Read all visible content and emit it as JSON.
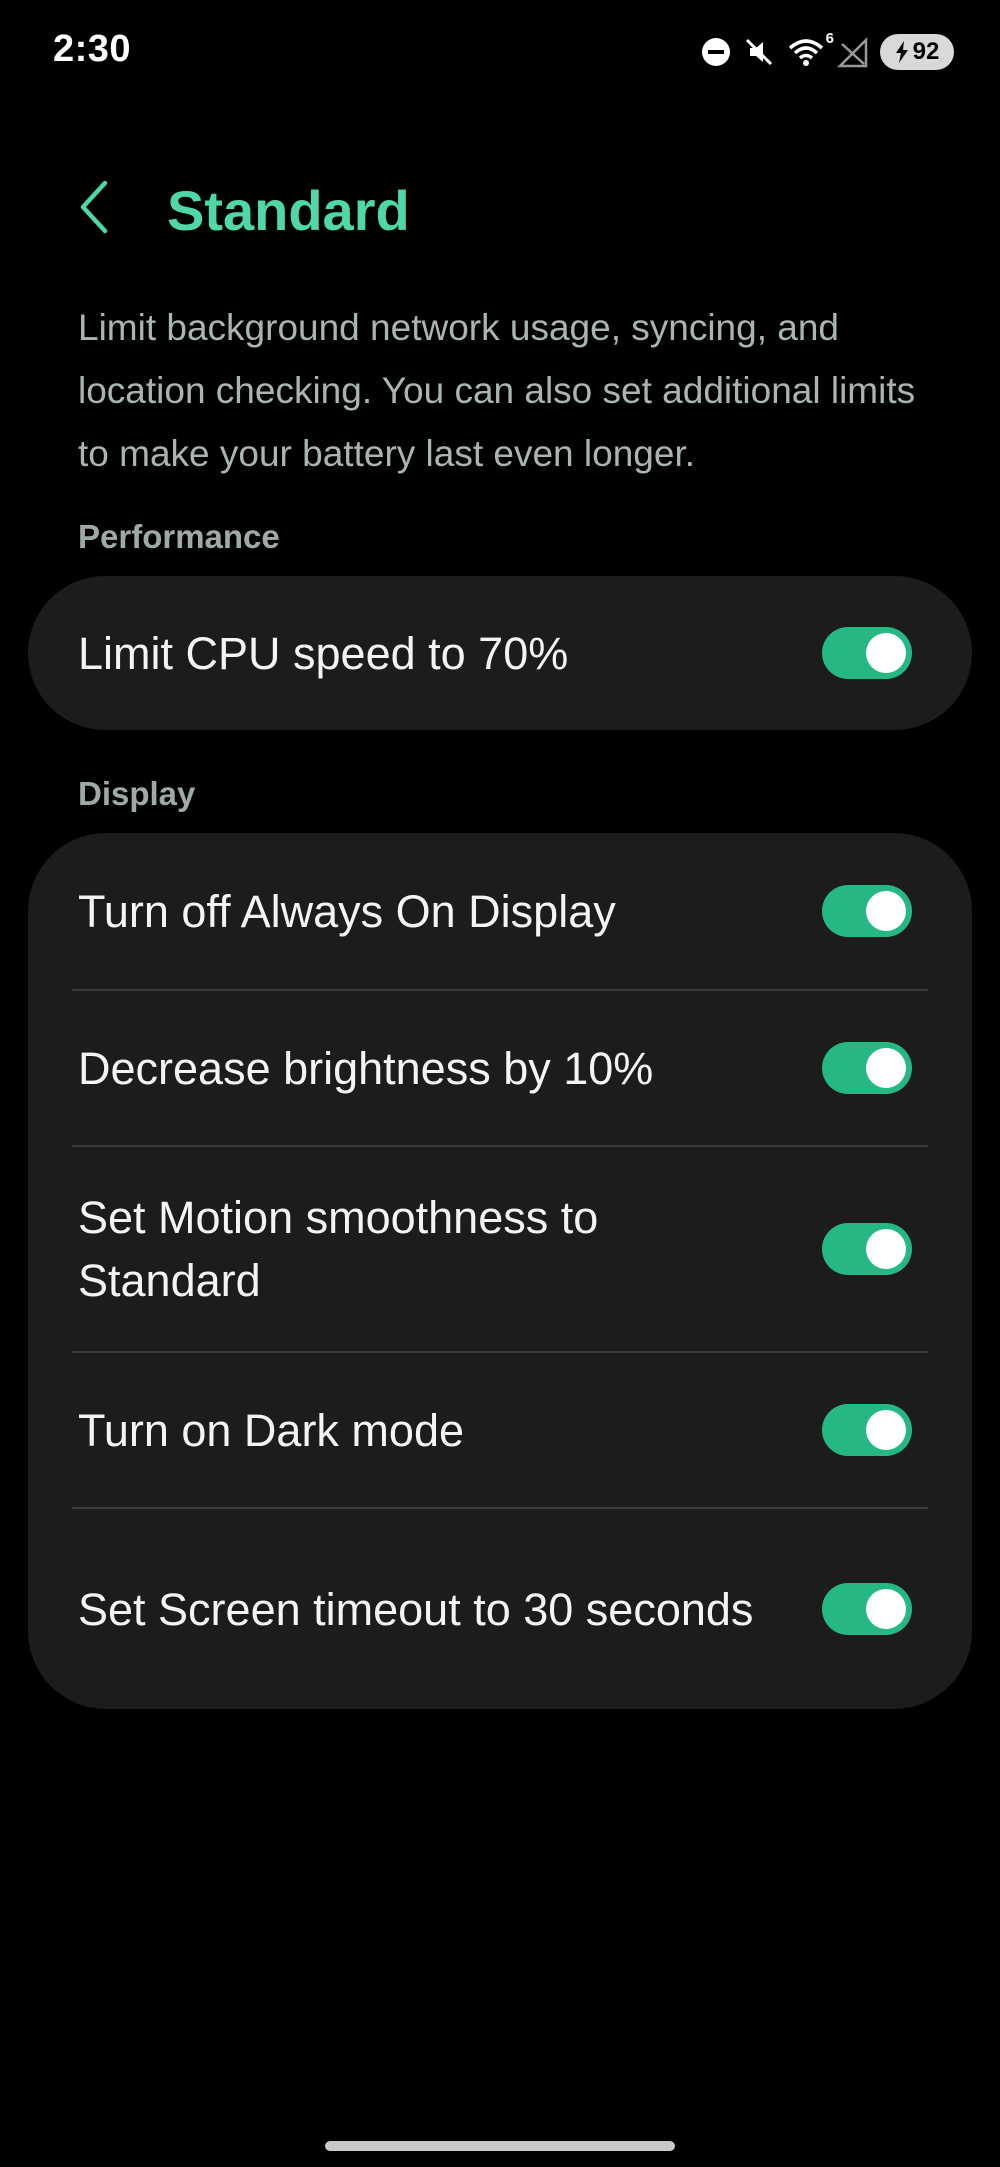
{
  "status_bar": {
    "time": "2:30",
    "wifi_badge": "6",
    "battery_level": "92",
    "icons": [
      "do-not-disturb-icon",
      "mute-icon",
      "wifi-icon",
      "no-signal-icon",
      "charging-bolt-icon"
    ]
  },
  "header": {
    "title": "Standard",
    "back_icon": "chevron-left-icon"
  },
  "description": "Limit background network usage, syncing, and location checking. You can also set additional limits to make your battery last even longer.",
  "sections": {
    "performance": {
      "title": "Performance",
      "items": [
        {
          "label": "Limit CPU speed to 70%",
          "enabled": true
        }
      ]
    },
    "display": {
      "title": "Display",
      "items": [
        {
          "label": "Turn off Always On Display",
          "enabled": true
        },
        {
          "label": "Decrease brightness by 10%",
          "enabled": true
        },
        {
          "label": "Set Motion smoothness to Standard",
          "enabled": true
        },
        {
          "label": "Turn on Dark mode",
          "enabled": true
        },
        {
          "label": "Set Screen timeout to 30 seconds",
          "enabled": true
        }
      ]
    }
  },
  "colors": {
    "accent": "#4fd8a5",
    "toggle_on": "#25b882",
    "card_bg": "#1c1c1c",
    "background": "#000000"
  }
}
